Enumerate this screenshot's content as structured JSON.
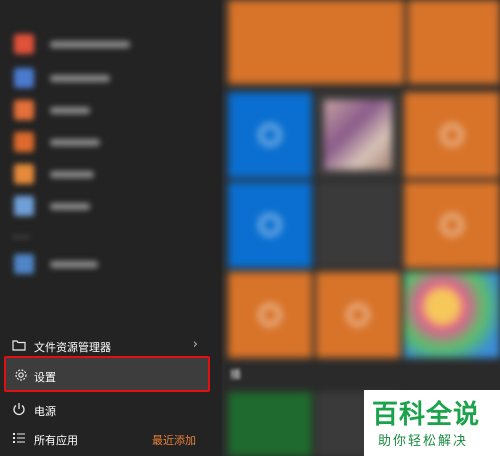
{
  "start_menu": {
    "items": [
      {
        "key": "file-explorer",
        "label": "文件资源管理器",
        "icon": "folder-icon"
      },
      {
        "key": "settings",
        "label": "设置",
        "icon": "gear-icon"
      },
      {
        "key": "power",
        "label": "电源",
        "icon": "power-icon"
      },
      {
        "key": "all-apps",
        "label": "所有应用",
        "icon": "list-icon"
      }
    ],
    "recent_label": "最近添加",
    "tile_group_label": "播"
  },
  "watermark": {
    "title": "百科全说",
    "subtitle": "助你轻松解决"
  },
  "colors": {
    "highlight": "#e11010",
    "accent_orange": "#d8742a",
    "accent_blue": "#0a6fd0",
    "watermark_green": "#1aa34a"
  }
}
